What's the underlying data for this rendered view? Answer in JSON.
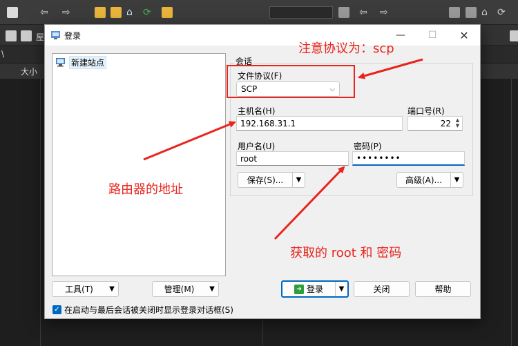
{
  "background": {
    "column_header": "大小",
    "path_fragment": "\\",
    "toolbar_fragment": "屋"
  },
  "dialog": {
    "title": "登录",
    "site_list": {
      "items": [
        {
          "label": "新建站点"
        }
      ]
    },
    "session": {
      "group_title": "会话",
      "protocol_label": "文件协议(F)",
      "protocol_value": "SCP",
      "host_label": "主机名(H)",
      "host_value": "192.168.31.1",
      "port_label": "端口号(R)",
      "port_value": "22",
      "user_label": "用户名(U)",
      "user_value": "root",
      "password_label": "密码(P)",
      "password_value": "••••••••",
      "save_label": "保存(S)...",
      "advanced_label": "高级(A)..."
    },
    "tools_label": "工具(T)",
    "manage_label": "管理(M)",
    "login_label": "登录",
    "close_label": "关闭",
    "help_label": "帮助",
    "checkbox_label": "在启动与最后会话被关闭时显示登录对话框(S)"
  },
  "annotations": {
    "protocol_note": "注意协议为：scp",
    "router_note": "路由器的地址",
    "root_note": "获取的 root 和 密码"
  },
  "colors": {
    "accent": "#0067c0",
    "annotation": "#e8241c"
  }
}
